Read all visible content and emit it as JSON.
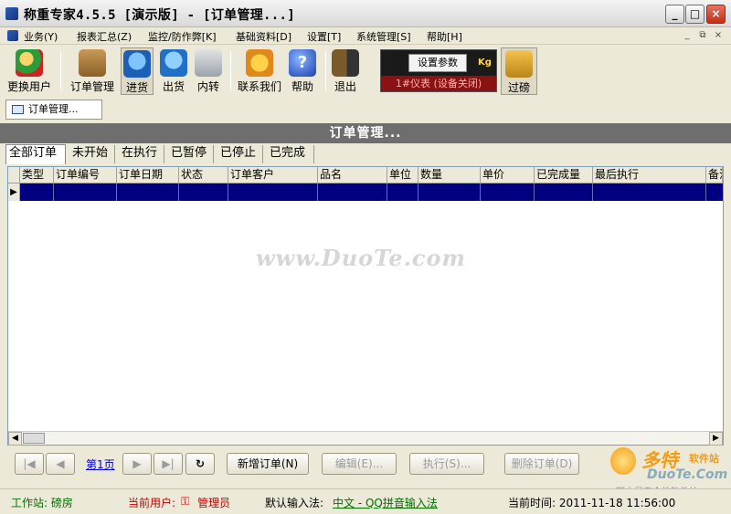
{
  "window": {
    "title": "称重专家4.5.5 [演示版]  - [订单管理...]",
    "min_label": "_",
    "max_label": "□",
    "close_label": "×"
  },
  "menubar": {
    "items": [
      "业务(Y)",
      "报表汇总(Z)",
      "监控/防作弊[K]",
      "基础资料[D]",
      "设置[T]",
      "系统管理[S]",
      "帮助[H]"
    ],
    "mdi_min": "_",
    "mdi_restore": "⧉",
    "mdi_close": "×"
  },
  "toolbar": {
    "buttons": [
      {
        "label": "更换用户",
        "icon": "user-switch-icon"
      },
      {
        "label": "订单管理",
        "icon": "order-box-icon"
      },
      {
        "label": "进货",
        "icon": "inbound-icon"
      },
      {
        "label": "出货",
        "icon": "outbound-icon"
      },
      {
        "label": "内转",
        "icon": "transfer-icon"
      },
      {
        "label": "联系我们",
        "icon": "phone-icon"
      },
      {
        "label": "帮助",
        "icon": "help-icon"
      },
      {
        "label": "退出",
        "icon": "exit-door-icon"
      },
      {
        "label": "过磅",
        "icon": "truck-weigh-icon"
      }
    ],
    "help_glyph": "?",
    "scale": {
      "set_label": "设置参数",
      "unit": "Kg",
      "status": "1#仪表 (设备关闭)"
    }
  },
  "doc_tab": {
    "label": "订单管理..."
  },
  "section": {
    "title": "订单管理..."
  },
  "filter_tabs": [
    "全部订单",
    "未开始",
    "在执行",
    "已暂停",
    "已停止",
    "已完成"
  ],
  "grid": {
    "columns": [
      "类型",
      "订单编号",
      "订单日期",
      "状态",
      "订单客户",
      "品名",
      "单位",
      "数量",
      "单价",
      "已完成量",
      "最后执行",
      "备注"
    ],
    "row_indicator": "▶",
    "scroll_left": "◀",
    "scroll_right": "▶"
  },
  "watermark": "www.DuoTe.com",
  "pager": {
    "first": "|◀",
    "prev": "◀",
    "page_label": "第1页",
    "next": "▶",
    "last": "▶|",
    "refresh": "↻"
  },
  "actions": {
    "new_order": "新增订单(N)",
    "edit": "编辑(E)...",
    "execute": "执行(S)...",
    "delete": "删除订单(D)"
  },
  "brand": {
    "big": "多特",
    "small": "软件站",
    "domain": "DuoTe.Com",
    "tag": "国内最安全的软件站"
  },
  "status": {
    "workstation": "工作站: 磅房",
    "current_user_label": "当前用户:",
    "current_user": "管理员",
    "ime_label": "默认输入法:",
    "ime": "中文 - QQ拼音输入法",
    "time": "当前时间: 2011-11-18 11:56:00"
  },
  "colors": {
    "selected_row": "#000080",
    "section_header": "#6e6e6e",
    "status_green": "#007000",
    "status_red": "#c00000"
  }
}
